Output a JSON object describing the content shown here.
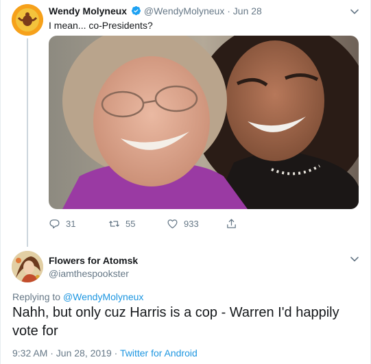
{
  "tweet": {
    "author_name": "Wendy Molyneux",
    "author_handle": "@WendyMolyneux",
    "separator": "·",
    "date": "Jun 28",
    "text": "I mean... co-Presidents?",
    "reply_count": "31",
    "retweet_count": "55",
    "like_count": "933"
  },
  "reply": {
    "author_name": "Flowers for Atomsk",
    "author_handle": "@iamthespookster",
    "replying_prefix": "Replying to",
    "replying_to": "@WendyMolyneux",
    "text": "Nahh, but only cuz Harris is a cop - Warren I'd happily vote for",
    "timestamp": "9:32 AM · Jun 28, 2019",
    "meta_separator": "·",
    "source": "Twitter for Android"
  },
  "colors": {
    "link": "#1b95e0",
    "secondary_text": "#657786",
    "verified_badge": "#1da1f2"
  }
}
